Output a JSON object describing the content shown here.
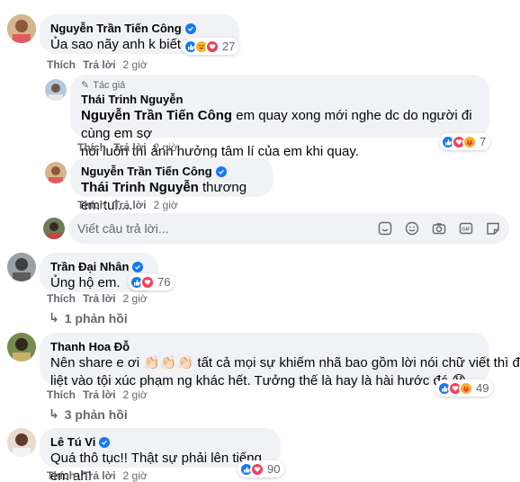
{
  "colors": {
    "accent": "#1877f2",
    "bubble": "#f0f2f5",
    "meta": "#65676b"
  },
  "comments": [
    {
      "author": "Nguyễn Trần Tiến Công",
      "verified": true,
      "text": "Ủa sao nãy anh k biết j ta",
      "like": "Thích",
      "reply": "Trả lời",
      "time": "2 giờ",
      "reactions": [
        "like",
        "haha",
        "love"
      ],
      "count": "27",
      "replies": [
        {
          "tag": "Tác giả",
          "author": "Thái Trinh Nguyễn",
          "mention": "Nguyễn Trần Tiến Công",
          "text_line1": " em quay xong mới nghe dc do người đi cùng em sợ",
          "text_line2": "nói luôn thì ảnh hưởng tâm lí của em khi quay.",
          "like": "Thích",
          "reply": "Trả lời",
          "time": "2 giờ",
          "reactions": [
            "like",
            "love",
            "care"
          ],
          "count": "7"
        },
        {
          "author": "Nguyễn Trần Tiến Công",
          "verified": true,
          "mention": "Thái Trinh Nguyễn",
          "text": " thương em tui....",
          "like": "Thích",
          "reply": "Trả lời",
          "time": "2 giờ"
        }
      ],
      "reply_box": {
        "placeholder": "Viết câu trả lời..."
      }
    },
    {
      "author": "Trần Đại Nhân",
      "verified": true,
      "text": "Ủng hộ em.",
      "like": "Thích",
      "reply": "Trả lời",
      "time": "2 giờ",
      "reactions": [
        "like",
        "love"
      ],
      "count": "76",
      "replies_label": "1 phản hồi"
    },
    {
      "author": "Thanh Hoa Đỗ",
      "text_line1": "Nên share e ơi 👏🏻👏🏻👏🏻 tất cả mọi sự khiếm nhã bao gồm lời nói chữ viết thì đều",
      "text_line2": "liệt vào tội xúc phạm ng khác hết. Tưởng thế là hay là hài hước đó 😓",
      "like": "Thích",
      "reply": "Trả lời",
      "time": "2 giờ",
      "reactions": [
        "like",
        "love",
        "care"
      ],
      "count": "49",
      "replies_label": "3 phản hồi"
    },
    {
      "author": "Lê Tú Vi",
      "verified": true,
      "text": "Quá thô tục!! Thật sự phải lên tiếng em ah!",
      "like": "Thích",
      "reply": "Trả lời",
      "time": "2 giờ",
      "reactions": [
        "like",
        "love"
      ],
      "count": "90"
    }
  ]
}
